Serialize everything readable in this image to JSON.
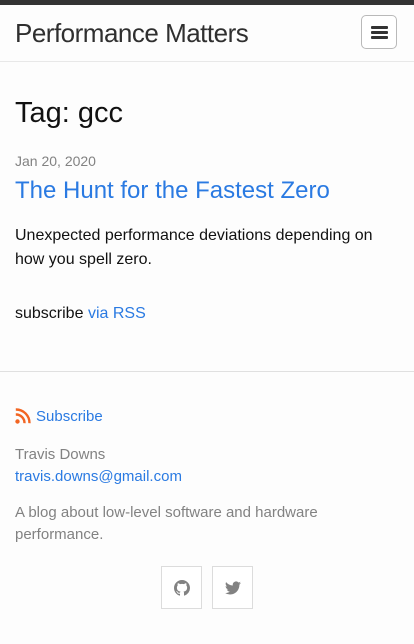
{
  "header": {
    "site_title": "Performance Matters",
    "menu_icon": "hamburger-menu-icon"
  },
  "main": {
    "page_heading": "Tag: gcc",
    "posts": [
      {
        "date": "Jan 20, 2020",
        "title": "The Hunt for the Fastest Zero",
        "excerpt": "Unexpected performance deviations depending on how you spell zero."
      }
    ],
    "subscribe_text": "subscribe",
    "subscribe_link": "via RSS"
  },
  "footer": {
    "rss_label": "Subscribe",
    "author_name": "Travis Downs",
    "email": "travis.downs@gmail.com",
    "description": "A blog about low-level software and hardware performance.",
    "social_icons": [
      "github-icon",
      "twitter-icon"
    ]
  },
  "colors": {
    "link": "#2a7ae2",
    "muted": "#828282",
    "rss": "#f26522"
  }
}
